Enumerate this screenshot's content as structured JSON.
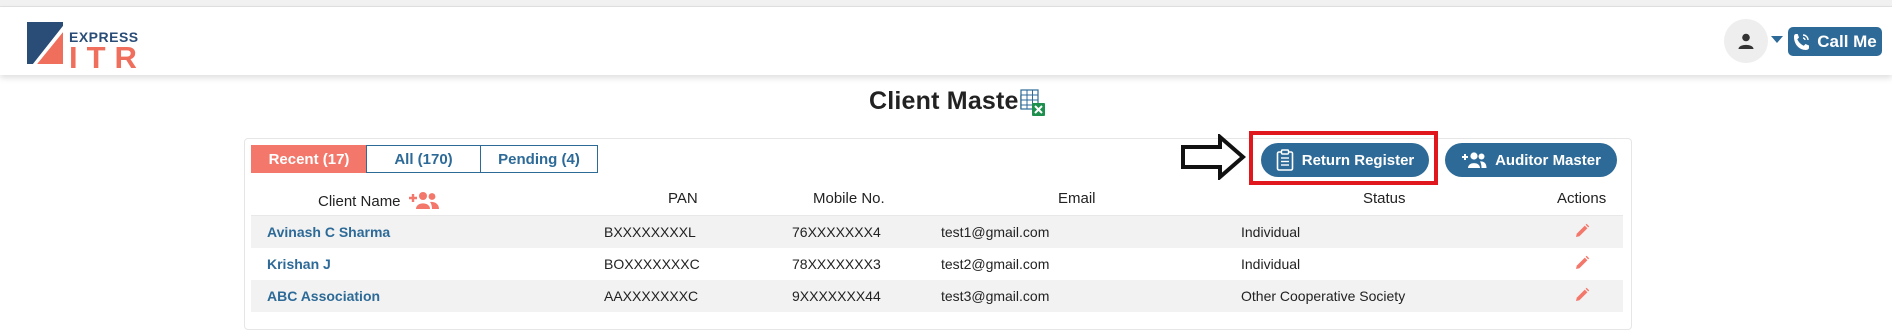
{
  "brand": {
    "express": "EXPRESS",
    "itr": "ITR",
    "colors": {
      "primary": "#2d6a97",
      "accent": "#f3776a",
      "highlight": "#e1171e"
    }
  },
  "header": {
    "avatar_icon": "user-icon",
    "dropdown_icon": "caret-down-icon",
    "call_icon": "phone-icon",
    "call_label": "Call Me"
  },
  "page": {
    "title": "Client Master",
    "export_icon": "excel-export-icon"
  },
  "tabs": [
    {
      "label": "Recent (17)",
      "active": true
    },
    {
      "label": "All (170)",
      "active": false
    },
    {
      "label": "Pending (4)",
      "active": false
    }
  ],
  "actions": {
    "return_register_label": "Return Register",
    "return_register_icon": "clipboard-icon",
    "auditor_master_label": "Auditor Master",
    "auditor_master_icon": "users-add-icon",
    "pointer_icon": "arrow-right-icon"
  },
  "table": {
    "columns": {
      "client_name": "Client Name",
      "pan": "PAN",
      "mobile": "Mobile No.",
      "email": "Email",
      "status": "Status",
      "actions": "Actions"
    },
    "add_client_icon": "add-users-icon",
    "edit_icon": "pencil-icon",
    "rows": [
      {
        "name": "Avinash C Sharma",
        "pan": "BXXXXXXXXL",
        "mobile": "76XXXXXXX4",
        "email": "test1@gmail.com",
        "status": "Individual"
      },
      {
        "name": "Krishan J",
        "pan": "BOXXXXXXXC",
        "mobile": "78XXXXXXX3",
        "email": "test2@gmail.com",
        "status": "Individual"
      },
      {
        "name": "ABC Association",
        "pan": "AAXXXXXXXC",
        "mobile": "9XXXXXXX44",
        "email": "test3@gmail.com",
        "status": "Other Cooperative Society"
      }
    ]
  }
}
